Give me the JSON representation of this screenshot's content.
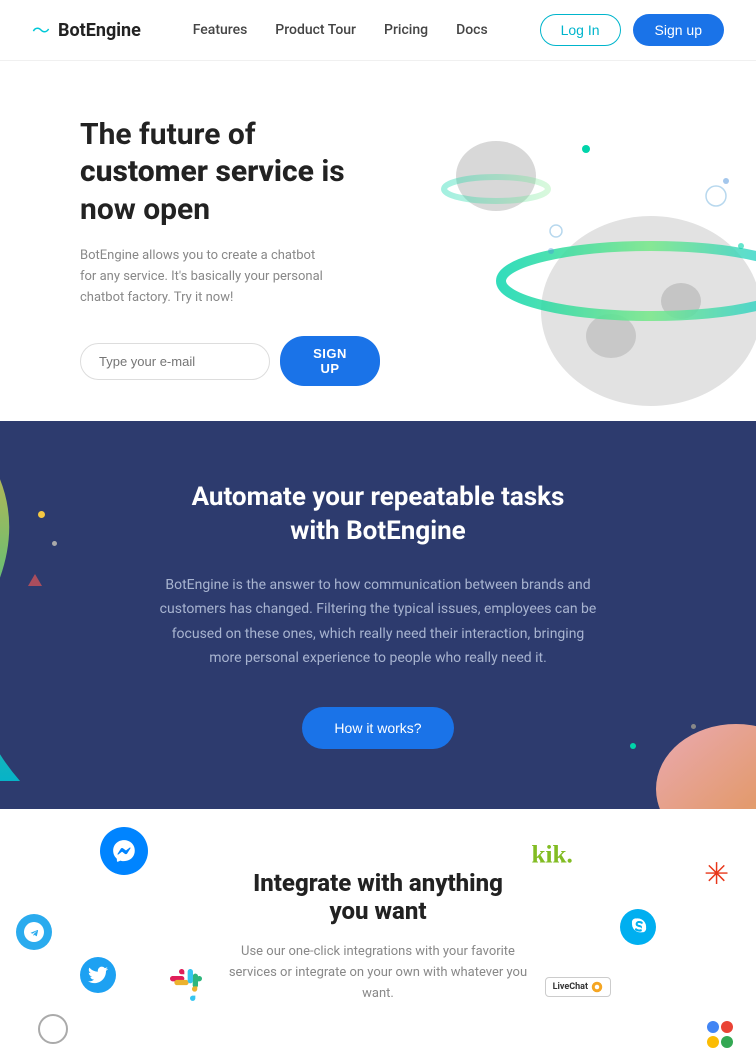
{
  "nav": {
    "logo_wave": "〜",
    "logo_text": "BotEngine",
    "links": [
      {
        "id": "features",
        "label": "Features"
      },
      {
        "id": "product-tour",
        "label": "Product Tour"
      },
      {
        "id": "pricing",
        "label": "Pricing"
      },
      {
        "id": "docs",
        "label": "Docs"
      }
    ],
    "login_label": "Log In",
    "signup_label": "Sign up"
  },
  "hero": {
    "title_plain": "The future of ",
    "title_highlight": "customer service",
    "title_suffix": " is now open",
    "description": "BotEngine allows you to create a chatbot for any service. It's basically your personal chatbot factory. Try it now!",
    "email_placeholder": "Type your e-mail",
    "signup_button": "SIGN UP"
  },
  "dark_section": {
    "heading_line1": "Automate your repeatable tasks",
    "heading_line2": "with BotEngine",
    "description": "BotEngine is the answer to how communication between brands and customers has changed. Filtering the typical issues, employees can be focused on these ones, which really need their interaction, bringing more personal experience to people who really need it.",
    "cta_button": "How it works?"
  },
  "integrate_section": {
    "heading_line1": "Integrate with anything",
    "heading_line2": "you want",
    "description": "Use our one-click integrations with your favorite services or integrate on your own with whatever you want.",
    "icons": {
      "messenger_color": "#0084ff",
      "telegram_color": "#2aabee",
      "twitter_color": "#1da1f2",
      "slack_colors": [
        "#e01e5a",
        "#36c5f0",
        "#2eb67d",
        "#ecb22e"
      ],
      "kik_color": "#82bc23",
      "snowflake_color": "#e8371a",
      "skype_color": "#00aff0",
      "livechat_text": "LiveChat",
      "google_dots": [
        "#4285f4",
        "#ea4335",
        "#fbbc04",
        "#34a853"
      ]
    }
  }
}
